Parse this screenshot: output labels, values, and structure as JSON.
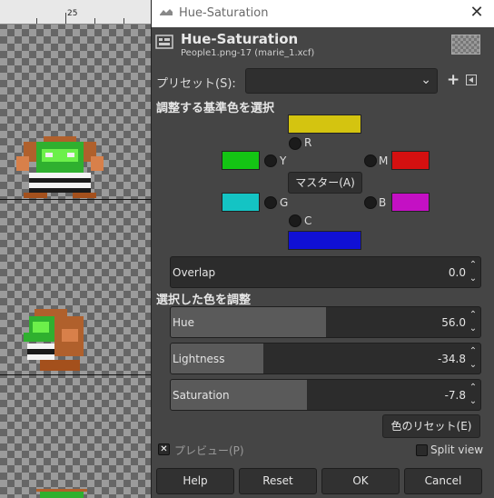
{
  "canvas": {
    "ruler_label": "25"
  },
  "window": {
    "title": "Hue-Saturation",
    "close_glyph": "✕"
  },
  "header": {
    "title": "Hue-Saturation",
    "subtitle": "People1.png-17 (marie_1.xcf)"
  },
  "presets": {
    "label": "プリセット(S):",
    "value": "",
    "add_glyph": "+"
  },
  "select_primary": {
    "heading": "調整する基準色を選択",
    "master_label": "マスター(A)",
    "colors": [
      {
        "key": "R",
        "label": "R",
        "swatch": "#d4c410"
      },
      {
        "key": "Y",
        "label": "Y",
        "swatch": "#14c414"
      },
      {
        "key": "M",
        "label": "M",
        "swatch": "#d41010"
      },
      {
        "key": "G",
        "label": "G",
        "swatch": "#14c4c4"
      },
      {
        "key": "B",
        "label": "B",
        "swatch": "#c410c4"
      },
      {
        "key": "C",
        "label": "C",
        "swatch": "#1010d4"
      }
    ]
  },
  "overlap": {
    "label": "Overlap",
    "value": "0.0",
    "fraction": 0.0
  },
  "adjust": {
    "heading": "選択した色を調整",
    "hue": {
      "label": "Hue",
      "value": "56.0",
      "fraction": 0.5
    },
    "lightness": {
      "label": "Lightness",
      "value": "-34.8",
      "fraction": 0.3
    },
    "saturation": {
      "label": "Saturation",
      "value": "-7.8",
      "fraction": 0.44
    },
    "reset_color_label": "色のリセット(E)"
  },
  "options": {
    "preview_label": "プレビュー(P)",
    "preview_checked": true,
    "split_view_label": "Split view",
    "split_view_checked": false
  },
  "buttons": {
    "help": "Help",
    "reset": "Reset",
    "ok": "OK",
    "cancel": "Cancel"
  }
}
